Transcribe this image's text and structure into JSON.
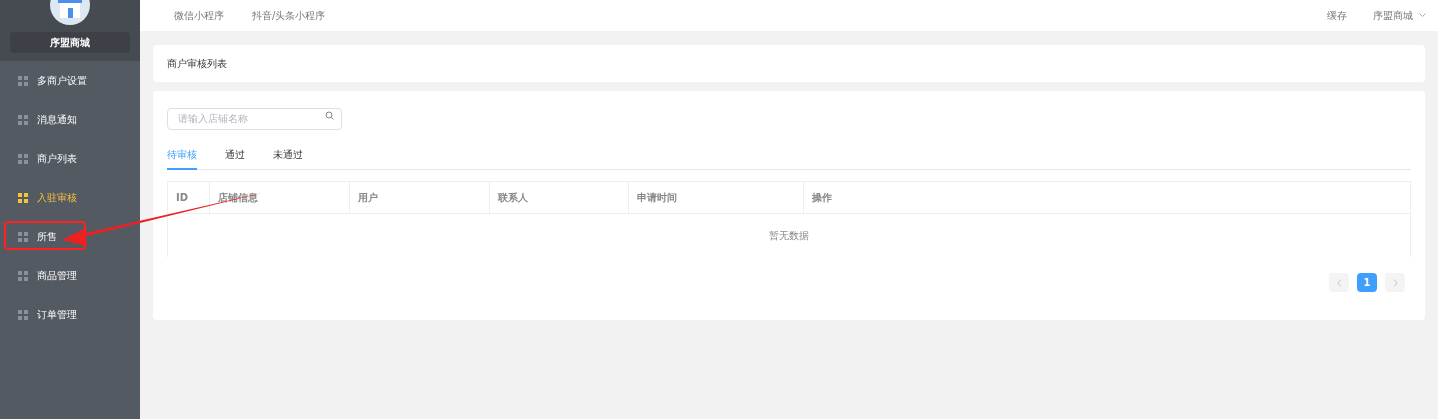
{
  "sidebar": {
    "shop_name": "序盟商城",
    "items": [
      {
        "label": "多商户设置",
        "selected": false
      },
      {
        "label": "消息通知",
        "selected": false
      },
      {
        "label": "商户列表",
        "selected": false
      },
      {
        "label": "入驻审核",
        "selected": true
      },
      {
        "label": "所售",
        "selected": false
      },
      {
        "label": "商品管理",
        "selected": false
      },
      {
        "label": "订单管理",
        "selected": false
      }
    ]
  },
  "top_nav": {
    "tabs": [
      "微信小程序",
      "抖音/头条小程序"
    ],
    "cache": "缓存",
    "user": "序盟商城"
  },
  "page_title": "商户审核列表",
  "search": {
    "placeholder": "请输入店铺名称"
  },
  "tabs": [
    {
      "label": "待审核",
      "selected": true
    },
    {
      "label": "通过",
      "selected": false
    },
    {
      "label": "未通过",
      "selected": false
    }
  ],
  "table": {
    "columns": [
      "ID",
      "店铺信息",
      "用户",
      "联系人",
      "申请时间",
      "操作"
    ],
    "empty_text": "暂无数据"
  },
  "pagination": {
    "pages": [
      {
        "label": "1",
        "selected": true
      }
    ]
  }
}
